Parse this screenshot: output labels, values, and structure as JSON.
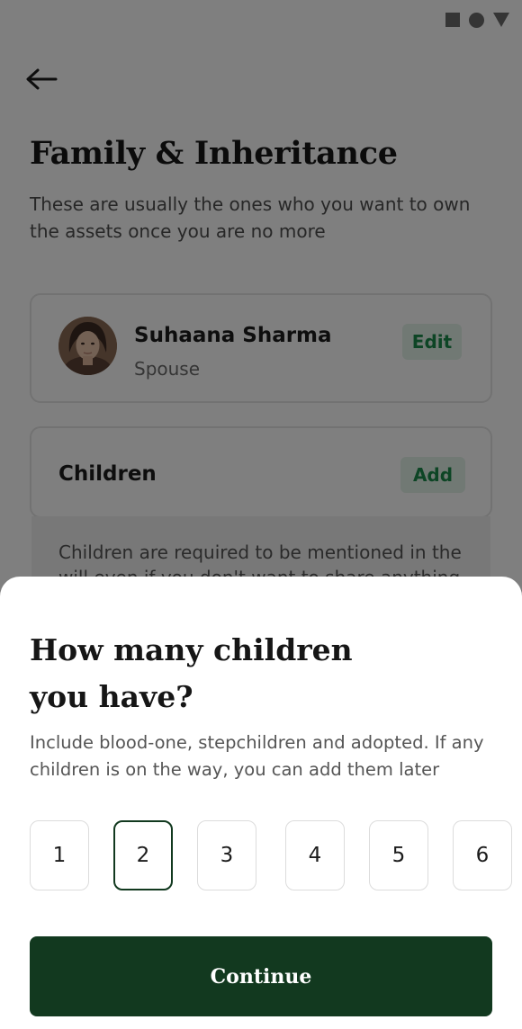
{
  "header": {
    "title": "Family & Inheritance",
    "subtitle": "These are usually the ones who you want to own the assets once you are no more"
  },
  "spouse_card": {
    "name": "Suhaana Sharma",
    "relation": "Spouse",
    "edit_label": "Edit"
  },
  "children_card": {
    "label": "Children",
    "add_label": "Add",
    "info": "Children are required to be mentioned in the will even if you don't want to share anything"
  },
  "sheet": {
    "title": "How many children you have?",
    "subtitle": "Include blood-one, stepchildren and adopted. If any children is on the way, you can add them later",
    "options": [
      "1",
      "2",
      "3",
      "4",
      "5",
      "6"
    ],
    "selected": "2",
    "continue_label": "Continue"
  },
  "icons": {
    "back": "arrow-left-icon",
    "status": [
      "square-icon",
      "circle-icon",
      "triangle-icon"
    ]
  },
  "colors": {
    "accent_dark_green": "#12391f",
    "edit_text_green": "#1b8a4a",
    "edit_bg": "#e3f3e8"
  }
}
